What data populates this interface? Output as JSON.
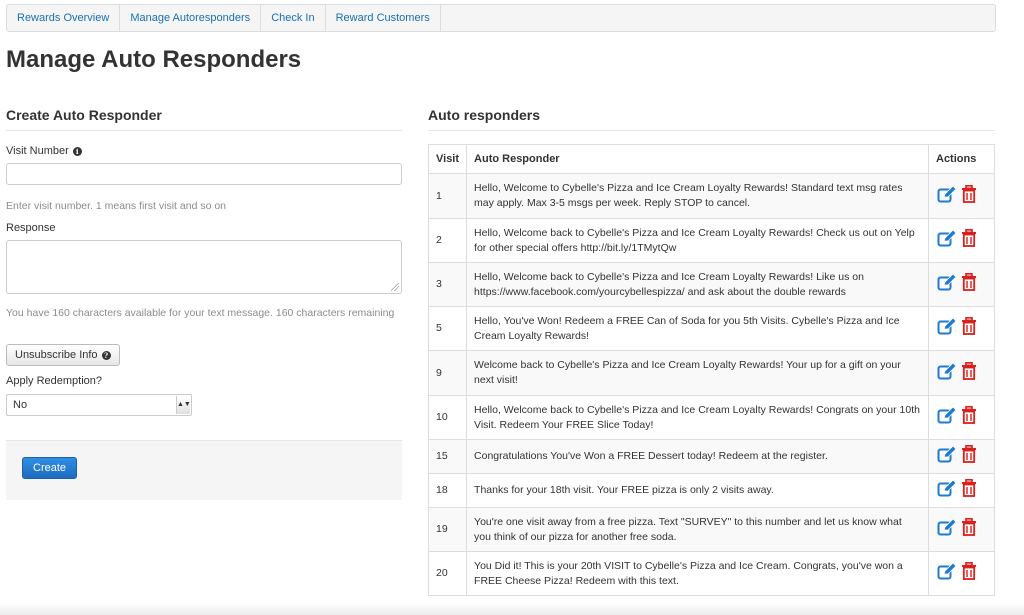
{
  "nav": {
    "items": [
      {
        "label": "Rewards Overview"
      },
      {
        "label": "Manage Autoresponders"
      },
      {
        "label": "Check In"
      },
      {
        "label": "Reward Customers"
      }
    ]
  },
  "page": {
    "title": "Manage Auto Responders"
  },
  "create": {
    "title": "Create Auto Responder",
    "visit_number_label": "Visit Number",
    "visit_number_value": "",
    "visit_number_help": "Enter visit number. 1 means first visit and so on",
    "response_label": "Response",
    "response_value": "",
    "chars_help": "You have 160 characters available for your text message. 160 characters remaining",
    "unsubscribe_label": "Unsubscribe Info",
    "redemption_label": "Apply Redemption?",
    "redemption_value": "No",
    "create_label": "Create"
  },
  "list": {
    "title": "Auto responders",
    "headers": {
      "visit": "Visit",
      "responder": "Auto Responder",
      "actions": "Actions"
    },
    "rows": [
      {
        "visit": "1",
        "text": "Hello, Welcome to Cybelle's Pizza and Ice Cream Loyalty Rewards! Standard text msg rates may apply. Max 3-5 msgs per week. Reply STOP to cancel."
      },
      {
        "visit": "2",
        "text": "Hello, Welcome back to Cybelle's Pizza and Ice Cream Loyalty Rewards! Check us out on Yelp for other special offers http://bit.ly/1TMytQw"
      },
      {
        "visit": "3",
        "text": "Hello, Welcome back to Cybelle's Pizza and Ice Cream Loyalty Rewards! Like us on https://www.facebook.com/yourcybellespizza/ and ask about the double rewards"
      },
      {
        "visit": "5",
        "text": "Hello, You've Won! Redeem a FREE Can of Soda for you 5th Visits. Cybelle's Pizza and Ice Cream Loyalty Rewards!"
      },
      {
        "visit": "9",
        "text": "Welcome back to Cybelle's Pizza and Ice Cream Loyalty Rewards! Your up for a gift on your next visit!"
      },
      {
        "visit": "10",
        "text": "Hello, Welcome back to Cybelle's Pizza and Ice Cream Loyalty Rewards! Congrats on your 10th Visit. Redeem Your FREE Slice Today!"
      },
      {
        "visit": "15",
        "text": "Congratulations You've Won a FREE Dessert today! Redeem at the register."
      },
      {
        "visit": "18",
        "text": "Thanks for your 18th visit. Your FREE pizza is only 2 visits away."
      },
      {
        "visit": "19",
        "text": "You're one visit away from a free pizza. Text \"SURVEY\" to this number and let us know what you think of our pizza for another free soda."
      },
      {
        "visit": "20",
        "text": "You Did it! This is your 20th VISIT to Cybelle's Pizza and Ice Cream. Congrats, you've won a FREE Cheese Pizza! Redeem with this text."
      }
    ]
  },
  "colors": {
    "link": "#1a6fb5",
    "edit_icon": "#1e7bd0",
    "delete_icon": "#d9201c",
    "primary": "#1e6cc0"
  },
  "icons": {
    "info": "info-circle-icon",
    "question": "question-circle-icon",
    "edit": "edit-icon",
    "delete": "trash-icon"
  }
}
